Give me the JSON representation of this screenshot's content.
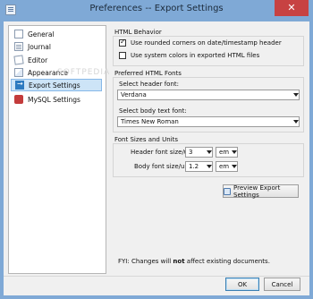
{
  "window": {
    "title": "Preferences -- Export Settings",
    "close_glyph": "✕"
  },
  "nav": {
    "items": [
      {
        "label": "General",
        "icon": "page-icon"
      },
      {
        "label": "Journal",
        "icon": "journal-icon"
      },
      {
        "label": "Editor",
        "icon": "editor-icon"
      },
      {
        "label": "Appearance",
        "icon": "appearance-icon"
      },
      {
        "label": "Export Settings",
        "icon": "export-icon",
        "selected": true
      },
      {
        "label": "MySQL Settings",
        "icon": "mysql-icon"
      }
    ],
    "watermark": "SOFTPEDIA"
  },
  "html_behavior": {
    "title": "HTML Behavior",
    "rounded_corners": {
      "label": "Use rounded corners on date/timestamp header",
      "checked": true
    },
    "system_colors": {
      "label": "Use system colors in exported HTML files",
      "checked": false
    }
  },
  "fonts": {
    "title": "Preferred HTML Fonts",
    "header_label": "Select header font:",
    "header_value": "Verdana",
    "body_label": "Select body text font:",
    "body_value": "Times New Roman"
  },
  "sizes": {
    "title": "Font Sizes and Units",
    "header_label": "Header font size/unit",
    "header_size": "3",
    "header_unit": "em",
    "body_label": "Body font size/unit",
    "body_size": "1.2",
    "body_unit": "em"
  },
  "preview_button": "Preview Export Settings",
  "fyi": {
    "prefix": "FYI: Changes will ",
    "emphasis": "not",
    "suffix": " affect existing documents."
  },
  "buttons": {
    "ok": "OK",
    "cancel": "Cancel"
  },
  "colors": {
    "titlebar": "#7fa9d6",
    "close": "#c74242",
    "selection": "#cde4f7"
  }
}
